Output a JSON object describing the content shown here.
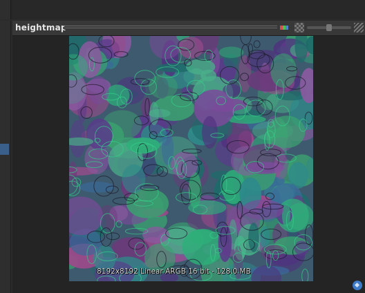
{
  "panel": {
    "title": "heightmap",
    "image_info": "8192x8192 Linear ARGB 16 bit - 128.0 MB"
  },
  "icons": {
    "channels": "channels-icon",
    "checker": "checker-icon",
    "menu": "menu-icon",
    "tag": "tag-icon"
  },
  "colors": {
    "panel_bg": "#242424",
    "titlebar_bg": "#383838",
    "accent": "#3a5f8a"
  }
}
